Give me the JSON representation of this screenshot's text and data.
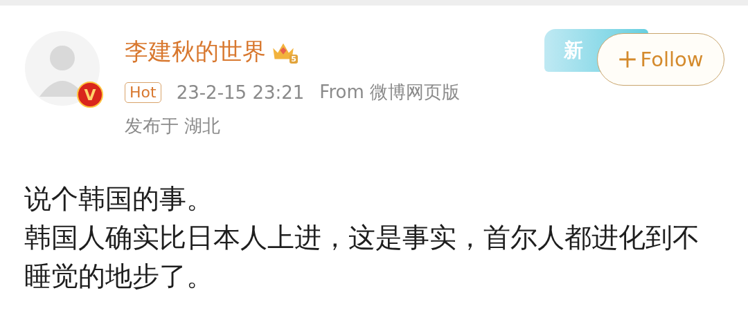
{
  "author": {
    "name": "李建秋的世界",
    "level_badge": "5",
    "verified_mark": "V"
  },
  "decoration": {
    "text": "新"
  },
  "follow_button": {
    "label": "Follow"
  },
  "meta": {
    "tag": "Hot",
    "time": "23-2-15 23:21",
    "source": "From 微博网页版",
    "location": "发布于 湖北"
  },
  "paragraphs": [
    "说个韩国的事。",
    "韩国人确实比日本人上进，这是事实，首尔人都进化到不睡觉的地步了。"
  ]
}
